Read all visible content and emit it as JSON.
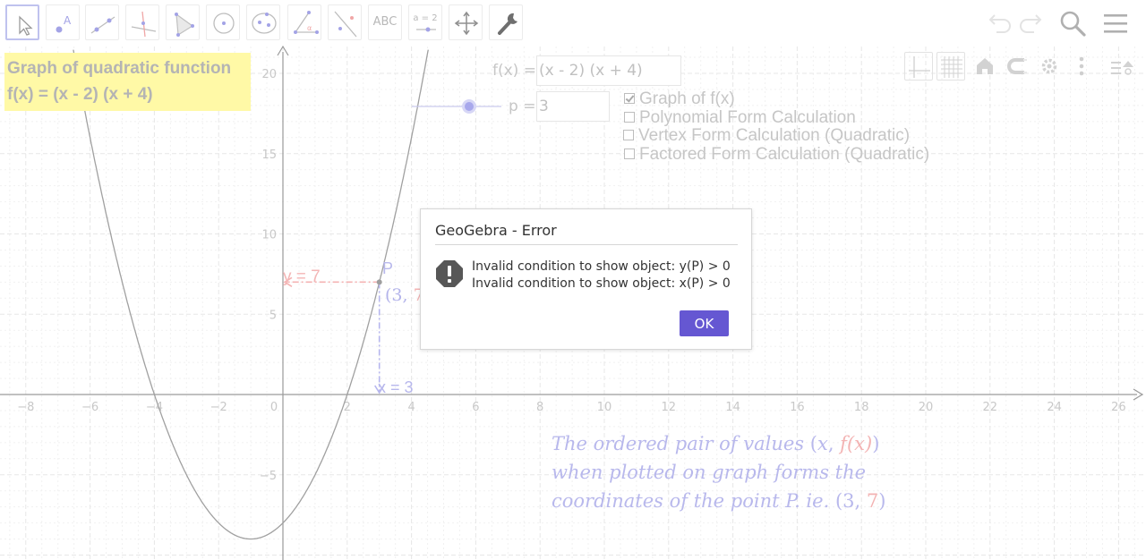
{
  "app": {
    "name": "GeoGebra",
    "accent": "#6557d2"
  },
  "toolbar": {
    "tools": [
      {
        "icon": "move-arrow-icon",
        "selected": true
      },
      {
        "icon": "point-icon"
      },
      {
        "icon": "line-icon"
      },
      {
        "icon": "perpendicular-line-icon"
      },
      {
        "icon": "polygon-icon"
      },
      {
        "icon": "circle-icon"
      },
      {
        "icon": "ellipse-icon"
      },
      {
        "icon": "angle-icon"
      },
      {
        "icon": "reflect-icon"
      },
      {
        "icon": "text-icon",
        "label": "ABC"
      },
      {
        "icon": "slider-icon",
        "label": "a = 2"
      },
      {
        "icon": "move-graphics-view-icon"
      },
      {
        "icon": "tools-wrench-icon"
      }
    ],
    "right": [
      "undo-icon",
      "redo-icon",
      "search-icon",
      "menu-icon"
    ]
  },
  "style_bar": [
    "axes-toggle-icon",
    "grid-toggle-icon",
    "home-icon",
    "magnet-icon",
    "settings-gear-icon",
    "more-vert-icon",
    "style-bar-toggle-icon"
  ],
  "title": {
    "line1": "Graph of quadratic function",
    "line2": "f(x) = (x - 2) (x + 4)",
    "background": "#fff9a6"
  },
  "inputs": {
    "function": {
      "label": "f(x) =",
      "value": "(x - 2) (x + 4)"
    },
    "slider": {
      "label": "p =",
      "value": "3"
    }
  },
  "checkboxes": [
    {
      "label": "Graph of f(x)",
      "checked": true
    },
    {
      "label": "Polynomial Form Calculation",
      "checked": false
    },
    {
      "label": "Vertex Form Calculation (Quadratic)",
      "checked": false
    },
    {
      "label": "Factored Form Calculation (Quadratic)",
      "checked": false
    }
  ],
  "graph": {
    "x_ticks": [
      "−8",
      "−6",
      "−4",
      "−2",
      "0",
      "2",
      "4",
      "6",
      "8",
      "10",
      "12",
      "14",
      "16",
      "18",
      "20",
      "22",
      "24",
      "26"
    ],
    "y_ticks": [
      "20",
      "15",
      "10",
      "5",
      "−5"
    ],
    "point": {
      "name": "P",
      "x": 3,
      "y": 7,
      "coord_open": "(3, ",
      "coord_y": "7",
      "coord_close": ")"
    },
    "label_y": "y = 7",
    "label_x": "x = 3",
    "colors": {
      "curve": "#a0a0a0",
      "point": "#b8b8ee",
      "red": "#f4b3b3"
    }
  },
  "description": {
    "line1_pre": "The ordered pair of values ",
    "line1_open": "(",
    "line1_x": "x",
    "line1_comma": ", ",
    "line1_fx": "f(x)",
    "line1_close": ")",
    "line2": "when plotted on graph forms the",
    "line3_pre": "coordinates of the point P. ie. ",
    "line3_open": "(3, ",
    "line3_y": "7",
    "line3_close": ")"
  },
  "dialog": {
    "title": "GeoGebra - Error",
    "messages": [
      "Invalid condition to show object: y(P) > 0",
      "Invalid condition to show object: x(P) > 0"
    ],
    "ok_label": "OK"
  }
}
